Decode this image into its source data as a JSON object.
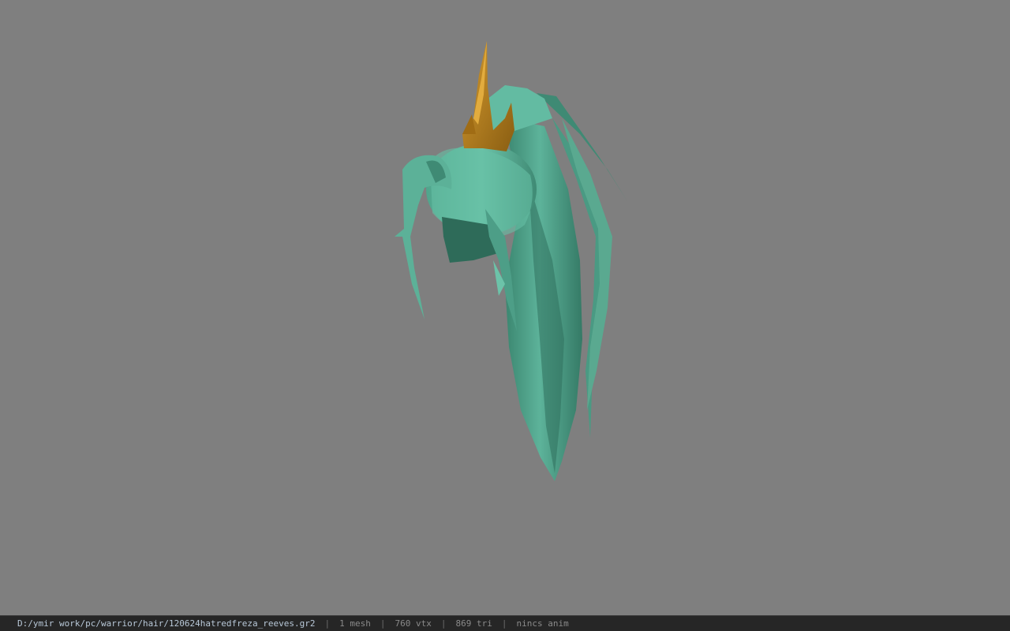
{
  "viewport": {
    "background": "#7f7f7f",
    "model": {
      "hair_color": "#5fb59c",
      "hair_shadow": "#3f8a74",
      "crown_color": "#b27d1e"
    }
  },
  "statusbar": {
    "path": "D:/ymir work/pc/warrior/hair/120624hatredfreza_reeves.gr2",
    "separator": "|",
    "mesh": "1 mesh",
    "vtx": "760 vtx",
    "tri": "869 tri",
    "anim": "nincs anim"
  }
}
